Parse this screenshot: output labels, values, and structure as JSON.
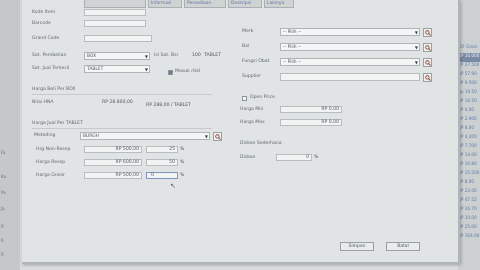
{
  "background": {
    "left_fragments": [
      "Fa",
      "Ka",
      "Pa",
      "Ja",
      "R",
      "R",
      "R"
    ],
    "right_list": [
      "IDF Grosi",
      "RP 10.000",
      "RP 27.500",
      "RP 57.90",
      "RP 9.500",
      "Rp 10.50",
      "RP 16.50",
      "RP 0.00",
      "RP 2.900",
      "RP 8.00",
      "RP 4.200",
      "RP 7.700",
      "RP 14.00",
      "RP 10.80",
      "RP 15.500",
      "RP 8.00",
      "RP 23.00",
      "RP 47.52",
      "RP 16.70",
      "RP 10.00",
      "RP 25.00",
      "RP 164.00"
    ]
  },
  "tabs": [
    "",
    "Informasi",
    "Persediaan",
    "Deskripsi",
    "Lainnya"
  ],
  "left_form": {
    "kode_label": "Kode Item",
    "barcode_label": "Barcode",
    "grand_code_label": "Grand Code",
    "sat_pembelian_label": "Sat. Pembelian",
    "sat_pembelian_value": "BOX",
    "isi_label": "Isi Sat. Bsr",
    "isi_value": "100",
    "isi_unit": "TABLET",
    "sat_jual_label": "Sat. Jual Terkecil",
    "sat_jual_value": "TABLET",
    "masuk_label": "Masuk ritel"
  },
  "right_form": {
    "merk_label": "Merk",
    "merk_value": "-- Pilih --",
    "bal_label": "Bal",
    "bal_value": "-- Pilih --",
    "jenis_label": "Fungsi Obat",
    "jenis_value": "-- Pilih --",
    "supplier_label": "Supplier"
  },
  "harga_beli": {
    "section": "Harga Beli Per BOX",
    "hpp_label": "Nilai HNA",
    "hpp_value": "RP 28.800,00",
    "per_unit": "RP 288,00 / TABLET"
  },
  "open_price": {
    "label": "Open Price",
    "harga_min_label": "Harga Min",
    "harga_min_value": "RP 0,00",
    "harga_max_label": "Harga Max",
    "harga_max_value": "RP 0,00"
  },
  "harga_jual": {
    "section": "Harga Jual Per TABLET",
    "metode_label": "Metoding",
    "metode_value": "BURGH",
    "rows": [
      {
        "label": "Hrg Non-Resep",
        "value": "RP 500,00",
        "pct": "25",
        "sign": "%"
      },
      {
        "label": "Harga Resep",
        "value": "RP 600,00",
        "pct": "50",
        "sign": "%"
      },
      {
        "label": "Harga Grosir",
        "value": "RP 500,00",
        "pct": "0",
        "sign": "%"
      }
    ]
  },
  "diskon": {
    "section": "Diskon Sederhana",
    "label": "Diskon",
    "value": "0",
    "sign": "%"
  },
  "buttons": {
    "simpan": "Simpan",
    "batal": "Batal"
  }
}
